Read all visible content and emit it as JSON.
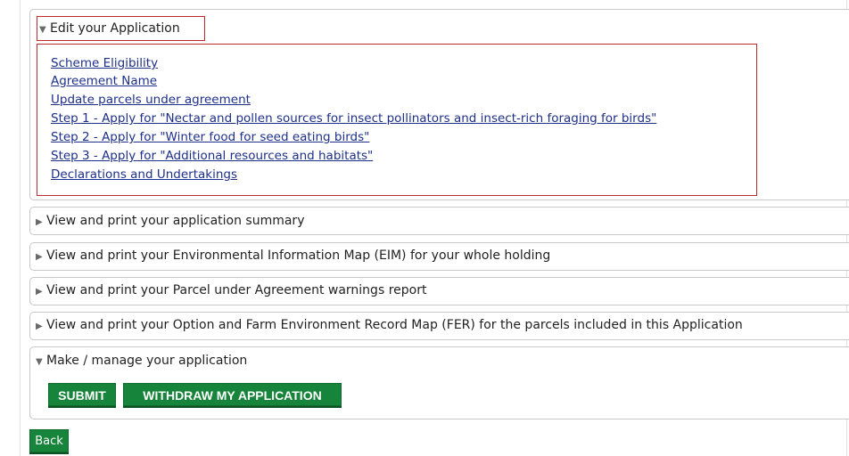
{
  "sections": {
    "edit": {
      "title": "Edit your Application",
      "links": [
        "Scheme Eligibility",
        "Agreement Name",
        "Update parcels under agreement",
        "Step 1 - Apply for \"Nectar and pollen sources for insect pollinators and insect-rich foraging for birds\"",
        "Step 2 - Apply for \"Winter food for seed eating birds\"",
        "Step 3 - Apply for \"Additional resources and habitats\"",
        "Declarations and Undertakings"
      ]
    },
    "summary": {
      "title": "View and print your application summary"
    },
    "eim": {
      "title": "View and print your Environmental Information Map (EIM) for your whole holding"
    },
    "warnings": {
      "title": "View and print your Parcel under Agreement warnings report"
    },
    "fer": {
      "title": "View and print your Option and Farm Environment Record Map (FER) for the parcels included in this Application"
    },
    "manage": {
      "title": "Make / manage your application",
      "submit_label": "SUBMIT",
      "withdraw_label": "WITHDRAW MY APPLICATION"
    }
  },
  "back_label": "Back",
  "icons": {
    "expanded": "triangle-down-icon",
    "collapsed": "triangle-right-icon"
  },
  "colors": {
    "button_green": "#16843a",
    "link_blue": "#1d2f8a",
    "highlight_red": "#c0282f"
  }
}
